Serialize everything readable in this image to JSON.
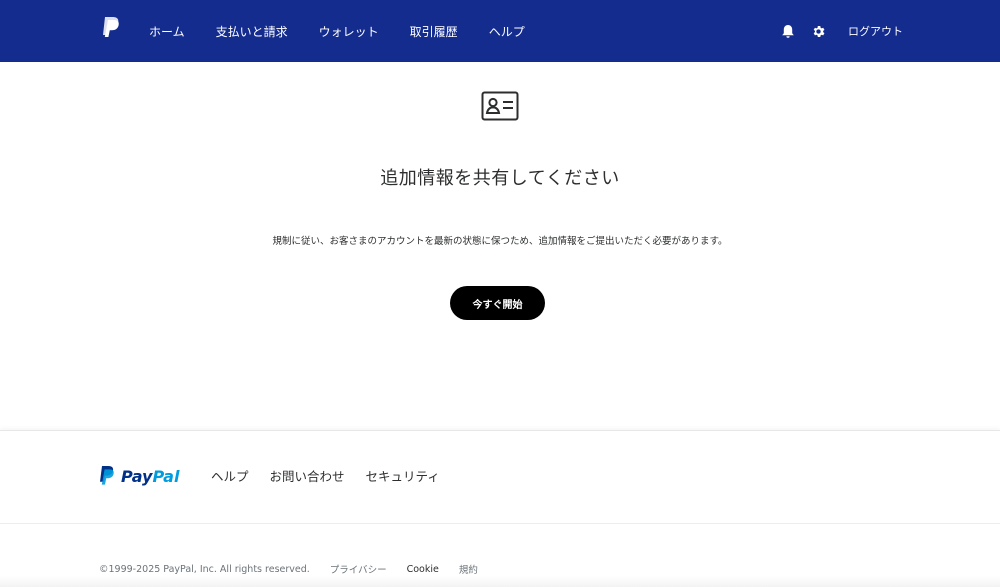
{
  "header": {
    "nav": [
      "ホーム",
      "支払いと請求",
      "ウォレット",
      "取引履歴",
      "ヘルプ"
    ],
    "logout_label": "ログアウト",
    "icons": {
      "logo": "paypal-logo-icon",
      "notifications": "bell-icon",
      "settings": "gear-icon"
    },
    "background": "#142c8e"
  },
  "main": {
    "icon": "id-card-icon",
    "title": "追加情報を共有してください",
    "description": "規制に従い、お客さまのアカウントを最新の状態に保つため、追加情報をご提出いただく必要があります。",
    "cta_label": "今すぐ開始",
    "cta_color": "#000000"
  },
  "footer": {
    "brand_pay": "Pay",
    "brand_pal": "Pal",
    "links": [
      "ヘルプ",
      "お問い合わせ",
      "セキュリティ"
    ],
    "copyright": "©1999-2025 PayPal, Inc. All rights reserved.",
    "legal_links": [
      "プライバシー",
      "Cookie",
      "規約"
    ],
    "brand_colors": {
      "primary": "#003087",
      "secondary": "#009cde"
    }
  }
}
